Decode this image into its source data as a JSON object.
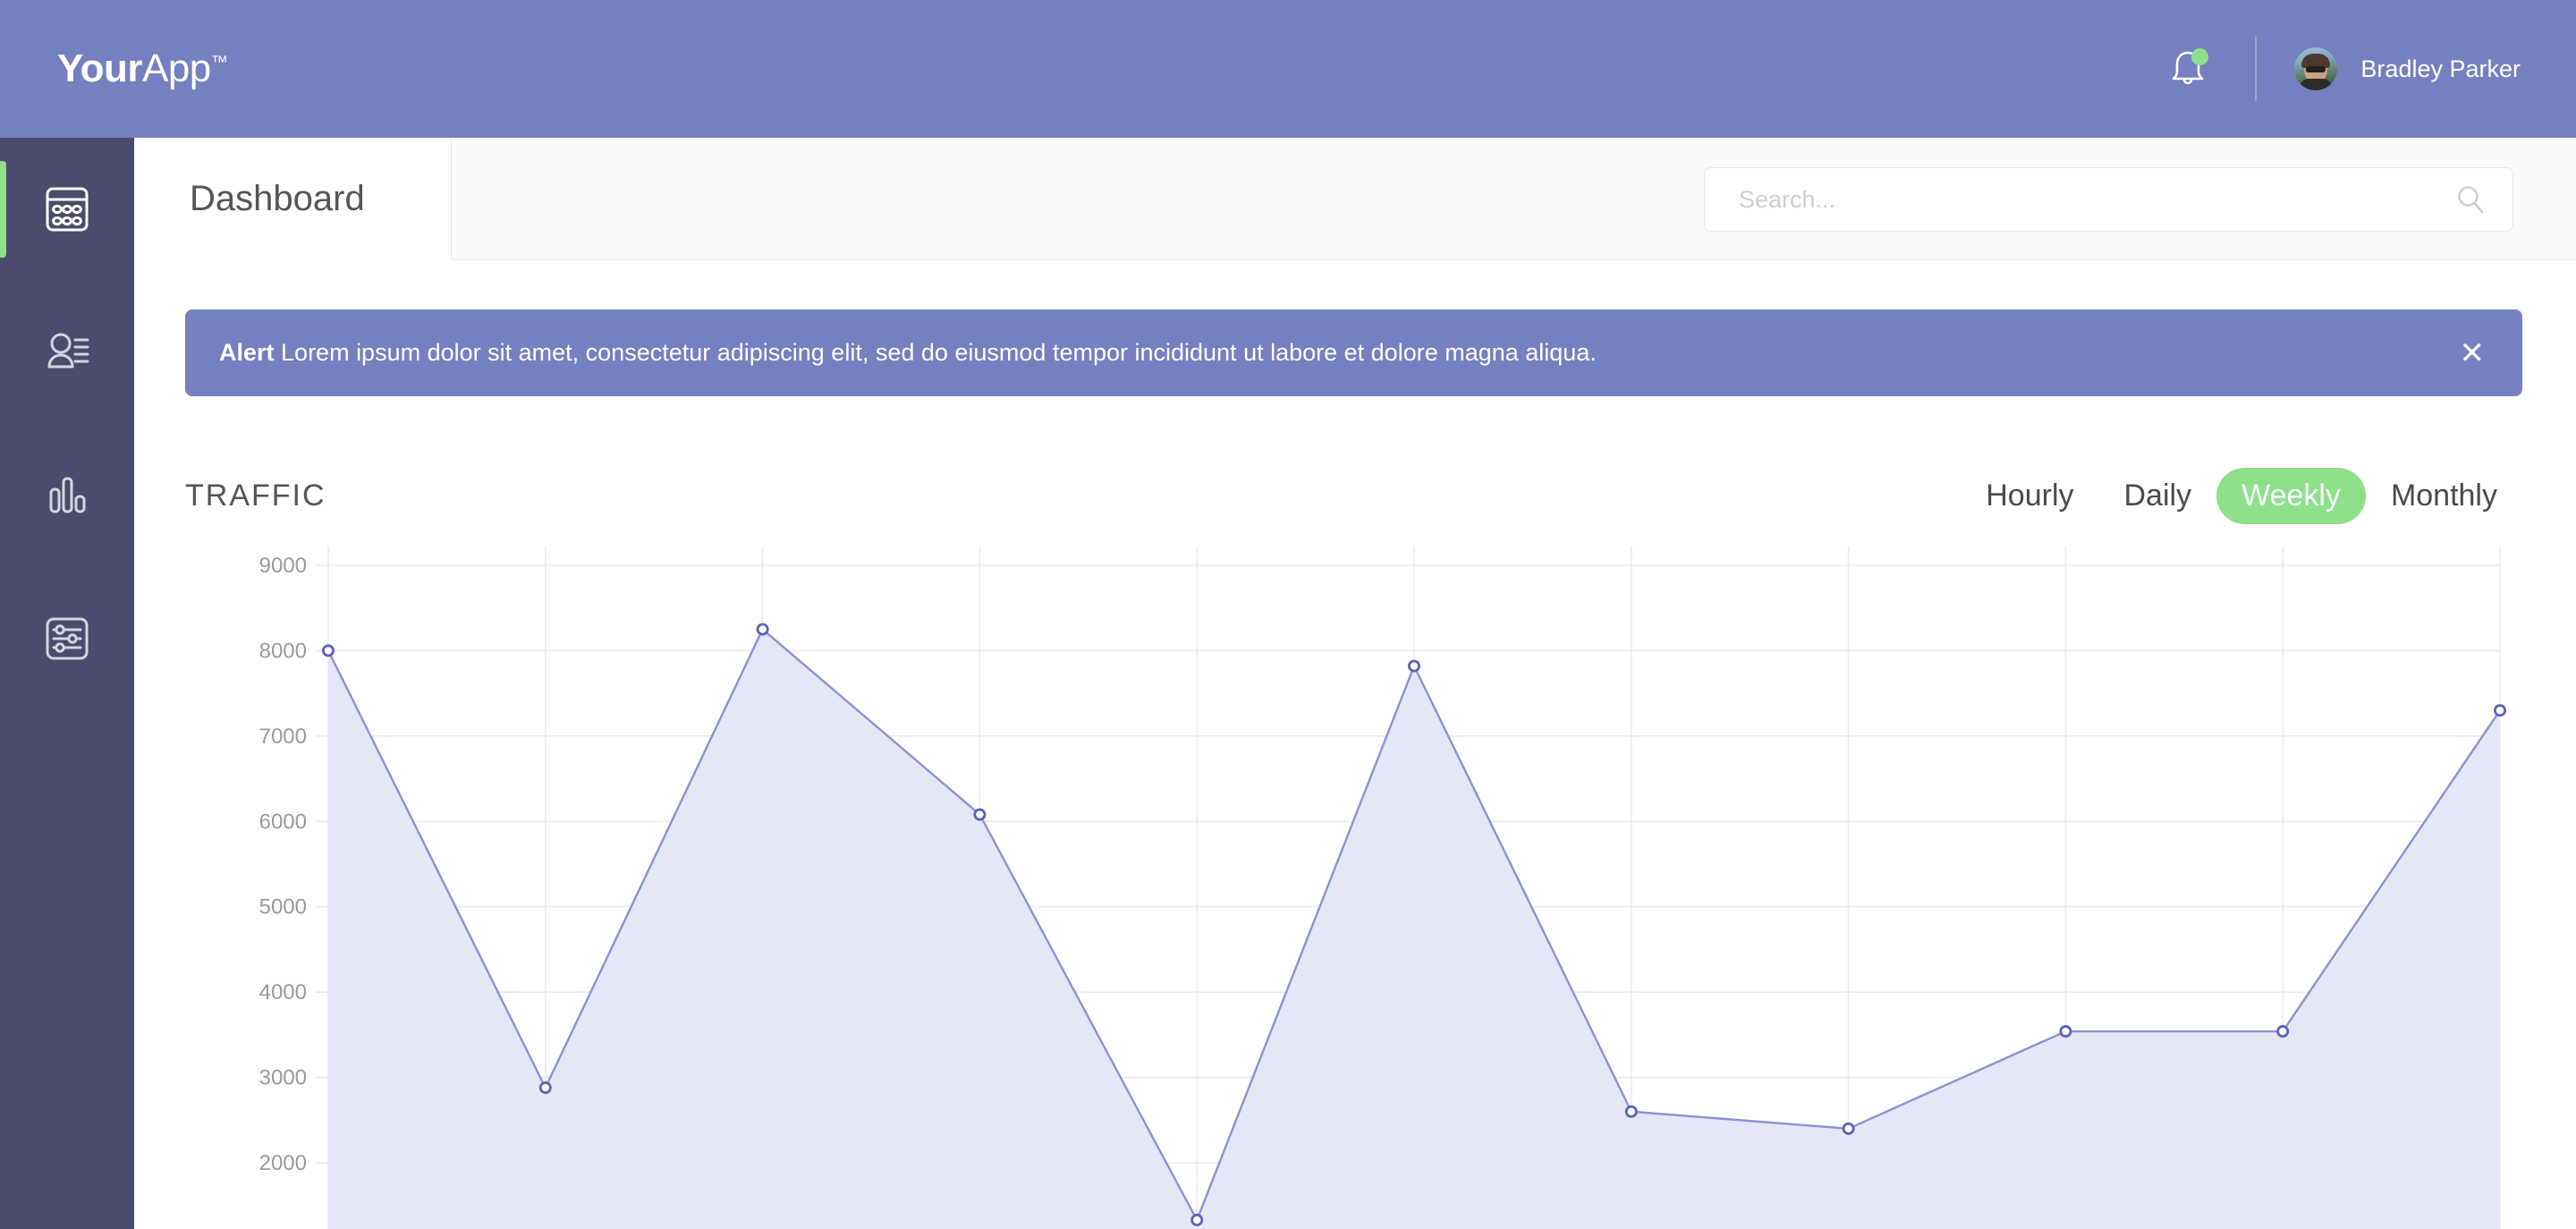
{
  "header": {
    "brand_bold": "Your",
    "brand_light": "App",
    "brand_tm": "™",
    "bell_icon": "bell-icon",
    "notification_dot_color": "#8ee08a",
    "user_name": "Bradley Parker",
    "bar_color": "#7480c0"
  },
  "sidebar": {
    "bg_color": "#4b4b6b",
    "active_indicator_color": "#8ee08a",
    "items": [
      {
        "icon": "calculator-icon",
        "active": true
      },
      {
        "icon": "user-list-icon",
        "active": false
      },
      {
        "icon": "bar-chart-icon",
        "active": false
      },
      {
        "icon": "sliders-settings-icon",
        "active": false
      }
    ]
  },
  "tabs": {
    "active_label": "Dashboard"
  },
  "search": {
    "placeholder": "Search...",
    "value": "",
    "icon": "search-icon"
  },
  "alert": {
    "label": "Alert",
    "message": "Lorem ipsum dolor sit amet, consectetur adipiscing elit, sed do eiusmod tempor incididunt ut labore et dolore magna aliqua.",
    "close_label": "✕",
    "bg_color": "#7480c0"
  },
  "panel": {
    "title": "TRAFFIC",
    "range_options": [
      {
        "label": "Hourly",
        "active": false
      },
      {
        "label": "Daily",
        "active": false
      },
      {
        "label": "Weekly",
        "active": true
      },
      {
        "label": "Monthly",
        "active": false
      }
    ],
    "active_pill_color": "#8ee08a"
  },
  "chart_data": {
    "type": "area",
    "title": "TRAFFIC",
    "xlabel": "",
    "ylabel": "",
    "x": [
      1,
      2,
      3,
      4,
      5,
      6,
      7,
      8,
      9,
      10,
      11
    ],
    "values": [
      8000,
      2880,
      8250,
      6080,
      1330,
      7820,
      2600,
      2400,
      3540,
      3540,
      7300
    ],
    "ytick_labels": [
      "9000",
      "8000",
      "7000",
      "6000",
      "5000",
      "4000",
      "3000",
      "2000"
    ],
    "yticks": [
      9000,
      8000,
      7000,
      6000,
      5000,
      4000,
      3000,
      2000
    ],
    "ylim": [
      1000,
      9000
    ],
    "grid": true,
    "legend": "none",
    "line_color": "#8a92d4",
    "fill_color": "#e6e7f6",
    "marker_color": "#5a63b8",
    "marker_fill": "#ffffff",
    "grid_color": "#ebebef"
  }
}
